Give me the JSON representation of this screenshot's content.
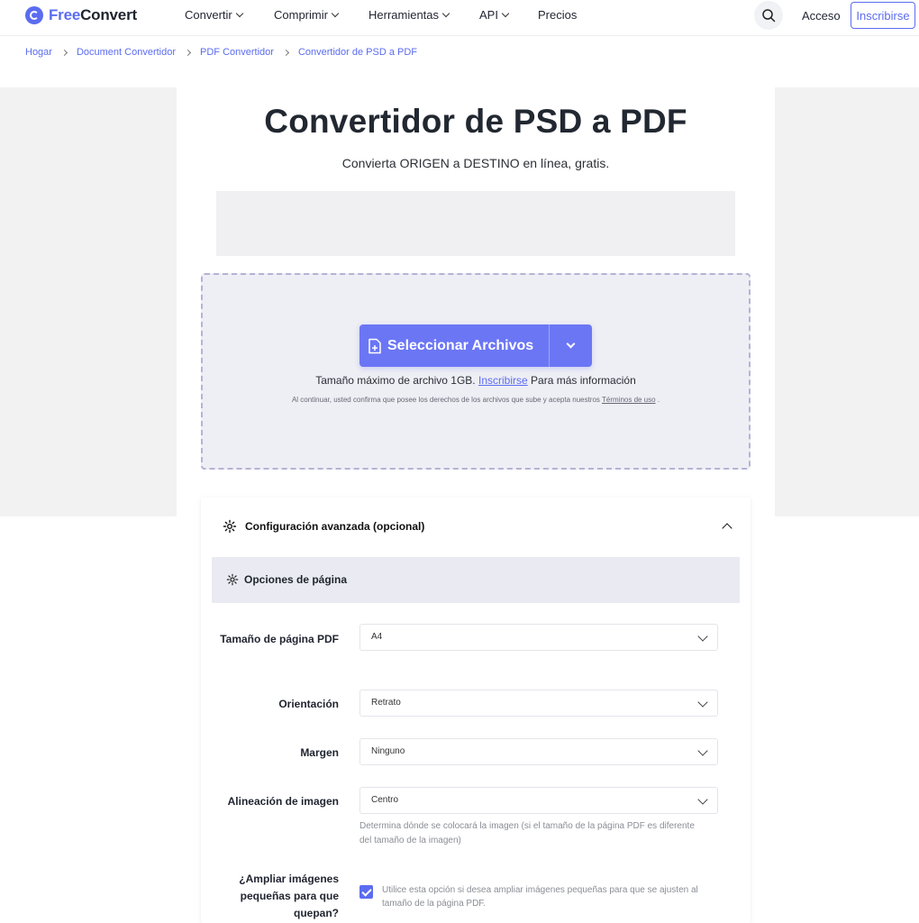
{
  "brand": {
    "free": "Free",
    "convert": "Convert"
  },
  "nav": {
    "items": [
      "Convertir",
      "Comprimir",
      "Herramientas",
      "API",
      "Precios"
    ],
    "login": "Acceso",
    "signup": "Inscribirse"
  },
  "breadcrumb": {
    "items": [
      "Hogar",
      "Document Convertidor",
      "PDF Convertidor"
    ],
    "current": "Convertidor de PSD a PDF"
  },
  "hero": {
    "title": "Convertidor de PSD a PDF",
    "subtitle": "Convierta ORIGEN a DESTINO en línea, gratis."
  },
  "upload": {
    "button": "Seleccionar Archivos",
    "max_size_prefix": "Tamaño máximo de archivo 1GB.",
    "max_size_link": "Inscribirse",
    "max_size_suffix": "Para más información",
    "terms_prefix": "Al continuar, usted confirma que posee los derechos de los archivos que sube y acepta nuestros",
    "terms_link": "Términos de uso",
    "terms_suffix": "."
  },
  "advanced": {
    "title": "Configuración avanzada (opcional)",
    "section": "Opciones de página",
    "fields": {
      "page_size": {
        "label": "Tamaño de página PDF",
        "value": "A4"
      },
      "orientation": {
        "label": "Orientación",
        "value": "Retrato"
      },
      "margin": {
        "label": "Margen",
        "value": "Ninguno"
      },
      "alignment": {
        "label": "Alineación de imagen",
        "value": "Centro",
        "help": "Determina dónde se colocará la imagen (si el tamaño de la página PDF es diferente del tamaño de la imagen)"
      },
      "enlarge": {
        "label": "¿Ampliar imágenes pequeñas para que quepan?",
        "checked": true,
        "help": "Utilice esta opción si desea ampliar imágenes pequeñas para que se ajusten al tamaño de la página PDF."
      }
    }
  },
  "colors": {
    "accent": "#5b6cf0",
    "button": "#6b76f5",
    "dropzone_bg": "#eeeef5"
  }
}
